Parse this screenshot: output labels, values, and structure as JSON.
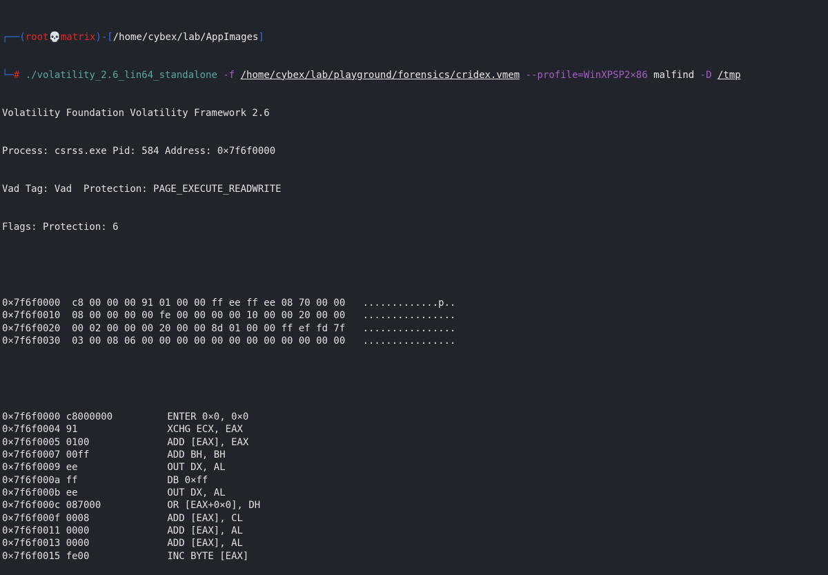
{
  "colors": {
    "background": "#22242c",
    "text": "#e2e2e2",
    "prompt_frame": "#2f6fd8",
    "prompt_user": "#e3261f",
    "command": "#57a99f",
    "option": "#a45cc4"
  },
  "prompt": {
    "frame_top": "┌──(",
    "user": "root",
    "skull": "💀",
    "host": "matrix",
    "sep": ")-[",
    "cwd": "/home/cybex/lab/AppImages",
    "close": "]",
    "frame_bottom": "└─",
    "hash": "#"
  },
  "command": {
    "program": "./volatility_2.6_lin64_standalone",
    "flag_f": "-f",
    "file": "/home/cybex/lab/playground/forensics/cridex.vmem",
    "profile": "--profile=WinXPSP2×86",
    "plugin": "malfind",
    "flag_d": "-D",
    "dir": "/tmp"
  },
  "output": {
    "header": [
      "Volatility Foundation Volatility Framework 2.6",
      "Process: csrss.exe Pid: 584 Address: 0×7f6f0000",
      "Vad Tag: Vad  Protection: PAGE_EXECUTE_READWRITE",
      "Flags: Protection: 6"
    ],
    "hexdump": [
      {
        "addr": "0×7f6f0000",
        "bytes": "c8 00 00 00 91 01 00 00 ff ee ff ee 08 70 00 00",
        "ascii": ".............p.."
      },
      {
        "addr": "0×7f6f0010",
        "bytes": "08 00 00 00 00 fe 00 00 00 00 10 00 00 20 00 00",
        "ascii": "................"
      },
      {
        "addr": "0×7f6f0020",
        "bytes": "00 02 00 00 00 20 00 00 8d 01 00 00 ff ef fd 7f",
        "ascii": "................"
      },
      {
        "addr": "0×7f6f0030",
        "bytes": "03 00 08 06 00 00 00 00 00 00 00 00 00 00 00 00",
        "ascii": "................"
      }
    ],
    "disasm": [
      {
        "addr": "0×7f6f0000",
        "bytes": "c8000000",
        "instr": "ENTER 0×0, 0×0"
      },
      {
        "addr": "0×7f6f0004",
        "bytes": "91",
        "instr": "XCHG ECX, EAX"
      },
      {
        "addr": "0×7f6f0005",
        "bytes": "0100",
        "instr": "ADD [EAX], EAX"
      },
      {
        "addr": "0×7f6f0007",
        "bytes": "00ff",
        "instr": "ADD BH, BH"
      },
      {
        "addr": "0×7f6f0009",
        "bytes": "ee",
        "instr": "OUT DX, AL"
      },
      {
        "addr": "0×7f6f000a",
        "bytes": "ff",
        "instr": "DB 0×ff"
      },
      {
        "addr": "0×7f6f000b",
        "bytes": "ee",
        "instr": "OUT DX, AL"
      },
      {
        "addr": "0×7f6f000c",
        "bytes": "087000",
        "instr": "OR [EAX+0×0], DH"
      },
      {
        "addr": "0×7f6f000f",
        "bytes": "0008",
        "instr": "ADD [EAX], CL"
      },
      {
        "addr": "0×7f6f0011",
        "bytes": "0000",
        "instr": "ADD [EAX], AL"
      },
      {
        "addr": "0×7f6f0013",
        "bytes": "0000",
        "instr": "ADD [EAX], AL"
      },
      {
        "addr": "0×7f6f0015",
        "bytes": "fe00",
        "instr": "INC BYTE [EAX]"
      }
    ]
  }
}
